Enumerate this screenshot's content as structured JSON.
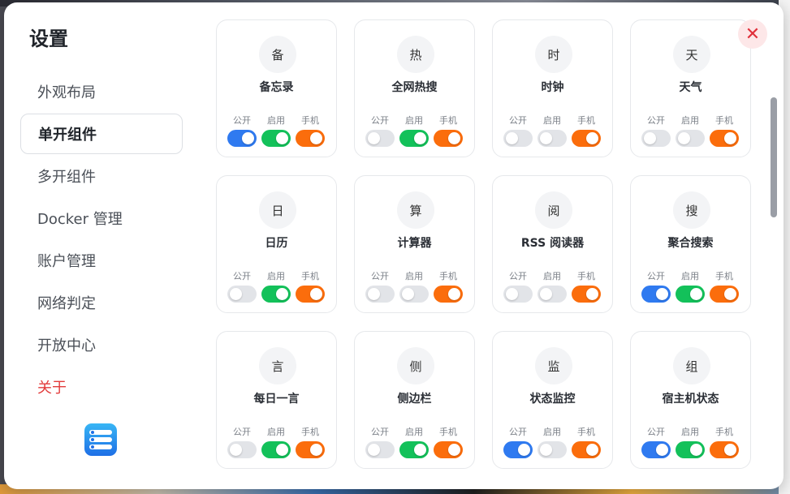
{
  "title": "设置",
  "close_glyph": "✕",
  "menu": [
    {
      "label": "外观布局",
      "active": false
    },
    {
      "label": "单开组件",
      "active": true
    },
    {
      "label": "多开组件",
      "active": false
    },
    {
      "label": "Docker 管理",
      "active": false
    },
    {
      "label": "账户管理",
      "active": false
    },
    {
      "label": "网络判定",
      "active": false
    },
    {
      "label": "开放中心",
      "active": false
    },
    {
      "label": "关于",
      "active": false
    }
  ],
  "toggle_labels": {
    "public": "公开",
    "enable": "启用",
    "mobile": "手机"
  },
  "colors": {
    "public_on": "#2f7af0",
    "enable_on": "#13c15a",
    "mobile_on": "#fb6d0c",
    "off": "#e2e4e8",
    "danger": "#e23b3b"
  },
  "widgets": [
    {
      "icon": "备",
      "name": "备忘录",
      "public": true,
      "enable": true,
      "mobile": true
    },
    {
      "icon": "热",
      "name": "全网热搜",
      "public": false,
      "enable": true,
      "mobile": true
    },
    {
      "icon": "时",
      "name": "时钟",
      "public": false,
      "enable": false,
      "mobile": true
    },
    {
      "icon": "天",
      "name": "天气",
      "public": false,
      "enable": false,
      "mobile": true
    },
    {
      "icon": "日",
      "name": "日历",
      "public": false,
      "enable": true,
      "mobile": true
    },
    {
      "icon": "算",
      "name": "计算器",
      "public": false,
      "enable": false,
      "mobile": true
    },
    {
      "icon": "阅",
      "name": "RSS 阅读器",
      "public": false,
      "enable": false,
      "mobile": true
    },
    {
      "icon": "搜",
      "name": "聚合搜索",
      "public": true,
      "enable": true,
      "mobile": true
    },
    {
      "icon": "言",
      "name": "每日一言",
      "public": false,
      "enable": true,
      "mobile": true
    },
    {
      "icon": "侧",
      "name": "侧边栏",
      "public": false,
      "enable": true,
      "mobile": true
    },
    {
      "icon": "监",
      "name": "状态监控",
      "public": true,
      "enable": false,
      "mobile": true
    },
    {
      "icon": "组",
      "name": "宿主机状态",
      "public": true,
      "enable": true,
      "mobile": true
    }
  ]
}
